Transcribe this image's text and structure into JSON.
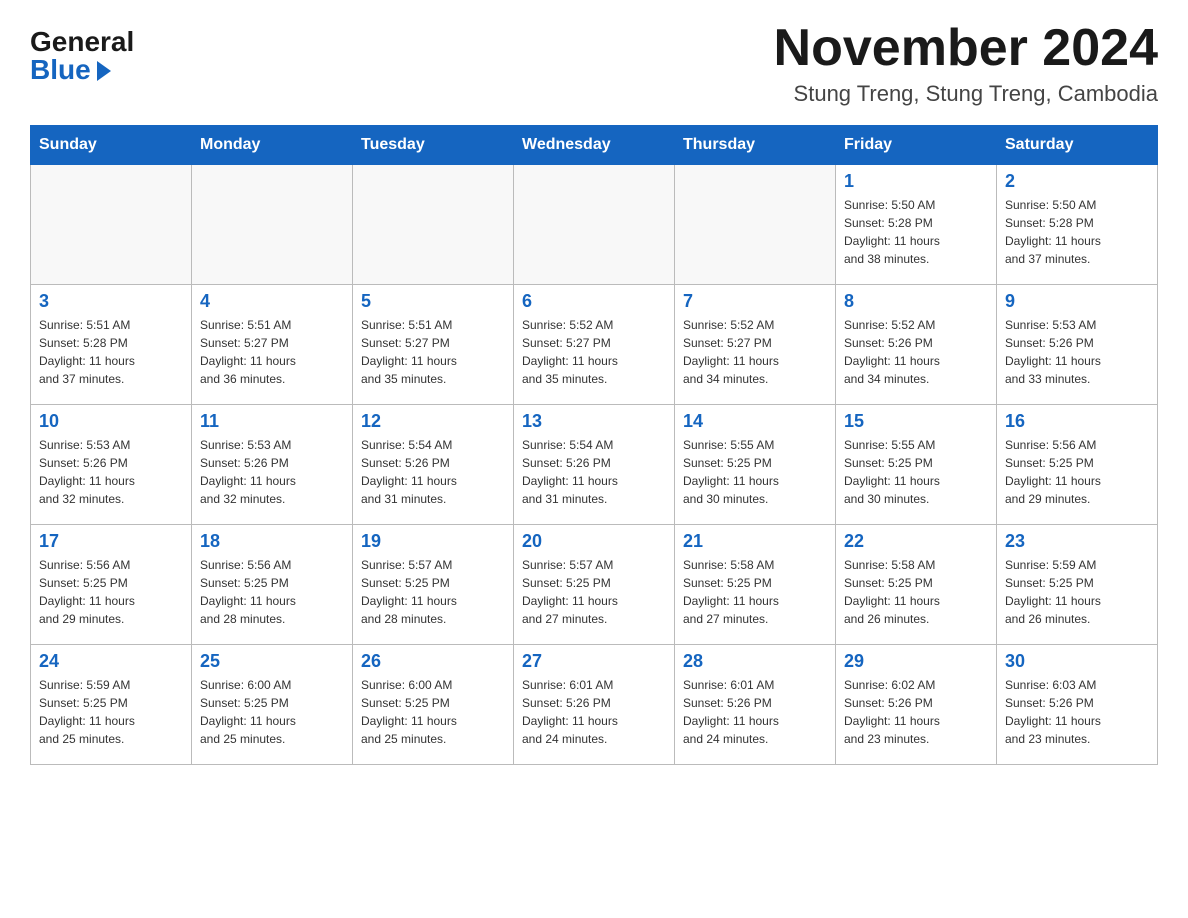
{
  "header": {
    "logo_general": "General",
    "logo_blue": "Blue",
    "month_title": "November 2024",
    "location": "Stung Treng, Stung Treng, Cambodia"
  },
  "days_of_week": [
    "Sunday",
    "Monday",
    "Tuesday",
    "Wednesday",
    "Thursday",
    "Friday",
    "Saturday"
  ],
  "weeks": [
    [
      {
        "day": "",
        "info": ""
      },
      {
        "day": "",
        "info": ""
      },
      {
        "day": "",
        "info": ""
      },
      {
        "day": "",
        "info": ""
      },
      {
        "day": "",
        "info": ""
      },
      {
        "day": "1",
        "info": "Sunrise: 5:50 AM\nSunset: 5:28 PM\nDaylight: 11 hours\nand 38 minutes."
      },
      {
        "day": "2",
        "info": "Sunrise: 5:50 AM\nSunset: 5:28 PM\nDaylight: 11 hours\nand 37 minutes."
      }
    ],
    [
      {
        "day": "3",
        "info": "Sunrise: 5:51 AM\nSunset: 5:28 PM\nDaylight: 11 hours\nand 37 minutes."
      },
      {
        "day": "4",
        "info": "Sunrise: 5:51 AM\nSunset: 5:27 PM\nDaylight: 11 hours\nand 36 minutes."
      },
      {
        "day": "5",
        "info": "Sunrise: 5:51 AM\nSunset: 5:27 PM\nDaylight: 11 hours\nand 35 minutes."
      },
      {
        "day": "6",
        "info": "Sunrise: 5:52 AM\nSunset: 5:27 PM\nDaylight: 11 hours\nand 35 minutes."
      },
      {
        "day": "7",
        "info": "Sunrise: 5:52 AM\nSunset: 5:27 PM\nDaylight: 11 hours\nand 34 minutes."
      },
      {
        "day": "8",
        "info": "Sunrise: 5:52 AM\nSunset: 5:26 PM\nDaylight: 11 hours\nand 34 minutes."
      },
      {
        "day": "9",
        "info": "Sunrise: 5:53 AM\nSunset: 5:26 PM\nDaylight: 11 hours\nand 33 minutes."
      }
    ],
    [
      {
        "day": "10",
        "info": "Sunrise: 5:53 AM\nSunset: 5:26 PM\nDaylight: 11 hours\nand 32 minutes."
      },
      {
        "day": "11",
        "info": "Sunrise: 5:53 AM\nSunset: 5:26 PM\nDaylight: 11 hours\nand 32 minutes."
      },
      {
        "day": "12",
        "info": "Sunrise: 5:54 AM\nSunset: 5:26 PM\nDaylight: 11 hours\nand 31 minutes."
      },
      {
        "day": "13",
        "info": "Sunrise: 5:54 AM\nSunset: 5:26 PM\nDaylight: 11 hours\nand 31 minutes."
      },
      {
        "day": "14",
        "info": "Sunrise: 5:55 AM\nSunset: 5:25 PM\nDaylight: 11 hours\nand 30 minutes."
      },
      {
        "day": "15",
        "info": "Sunrise: 5:55 AM\nSunset: 5:25 PM\nDaylight: 11 hours\nand 30 minutes."
      },
      {
        "day": "16",
        "info": "Sunrise: 5:56 AM\nSunset: 5:25 PM\nDaylight: 11 hours\nand 29 minutes."
      }
    ],
    [
      {
        "day": "17",
        "info": "Sunrise: 5:56 AM\nSunset: 5:25 PM\nDaylight: 11 hours\nand 29 minutes."
      },
      {
        "day": "18",
        "info": "Sunrise: 5:56 AM\nSunset: 5:25 PM\nDaylight: 11 hours\nand 28 minutes."
      },
      {
        "day": "19",
        "info": "Sunrise: 5:57 AM\nSunset: 5:25 PM\nDaylight: 11 hours\nand 28 minutes."
      },
      {
        "day": "20",
        "info": "Sunrise: 5:57 AM\nSunset: 5:25 PM\nDaylight: 11 hours\nand 27 minutes."
      },
      {
        "day": "21",
        "info": "Sunrise: 5:58 AM\nSunset: 5:25 PM\nDaylight: 11 hours\nand 27 minutes."
      },
      {
        "day": "22",
        "info": "Sunrise: 5:58 AM\nSunset: 5:25 PM\nDaylight: 11 hours\nand 26 minutes."
      },
      {
        "day": "23",
        "info": "Sunrise: 5:59 AM\nSunset: 5:25 PM\nDaylight: 11 hours\nand 26 minutes."
      }
    ],
    [
      {
        "day": "24",
        "info": "Sunrise: 5:59 AM\nSunset: 5:25 PM\nDaylight: 11 hours\nand 25 minutes."
      },
      {
        "day": "25",
        "info": "Sunrise: 6:00 AM\nSunset: 5:25 PM\nDaylight: 11 hours\nand 25 minutes."
      },
      {
        "day": "26",
        "info": "Sunrise: 6:00 AM\nSunset: 5:25 PM\nDaylight: 11 hours\nand 25 minutes."
      },
      {
        "day": "27",
        "info": "Sunrise: 6:01 AM\nSunset: 5:26 PM\nDaylight: 11 hours\nand 24 minutes."
      },
      {
        "day": "28",
        "info": "Sunrise: 6:01 AM\nSunset: 5:26 PM\nDaylight: 11 hours\nand 24 minutes."
      },
      {
        "day": "29",
        "info": "Sunrise: 6:02 AM\nSunset: 5:26 PM\nDaylight: 11 hours\nand 23 minutes."
      },
      {
        "day": "30",
        "info": "Sunrise: 6:03 AM\nSunset: 5:26 PM\nDaylight: 11 hours\nand 23 minutes."
      }
    ]
  ]
}
